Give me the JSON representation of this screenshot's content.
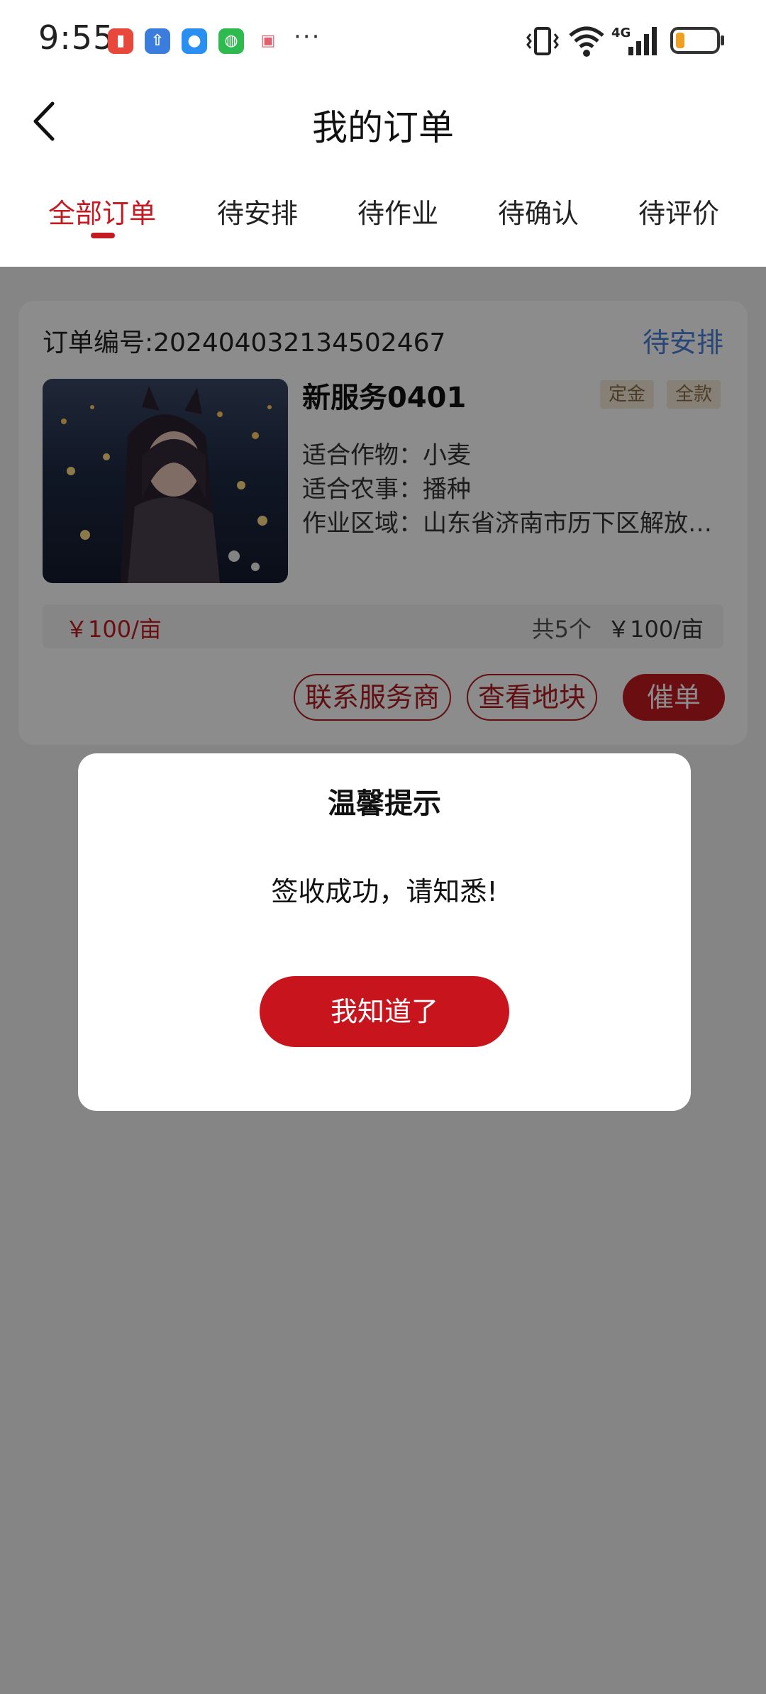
{
  "status_bar": {
    "time": "9:55",
    "more": "···",
    "icons": [
      "battery-saver-app-icon",
      "upload-app-icon",
      "message-app-icon",
      "wechat-icon",
      "box-app-icon",
      "vibrate-icon",
      "wifi-icon",
      "signal-4g-icon",
      "battery-icon"
    ],
    "network": "4G"
  },
  "nav": {
    "title": "我的订单"
  },
  "tabs": [
    {
      "label": "全部订单",
      "active": true
    },
    {
      "label": "待安排",
      "active": false
    },
    {
      "label": "待作业",
      "active": false
    },
    {
      "label": "待确认",
      "active": false
    },
    {
      "label": "待评价",
      "active": false
    }
  ],
  "order": {
    "order_no": "订单编号:202404032134502467",
    "status": "待安排",
    "service_name": "新服务0401",
    "tags": [
      "定金",
      "全款"
    ],
    "crop_label": "适合作物：",
    "crop_value": "小麦",
    "farm_label": "适合农事：",
    "farm_value": "播种",
    "area_label": "作业区域：",
    "area_value": "山东省济南市历下区解放…",
    "unit_price": "￥100/亩",
    "count": "共5个",
    "total_price": "￥100/亩",
    "buttons": {
      "contact": "联系服务商",
      "view_plot": "查看地块",
      "urge": "催单"
    }
  },
  "dialog": {
    "title": "温馨提示",
    "message": "签收成功，请知悉!",
    "confirm": "我知道了"
  },
  "colors": {
    "accent": "#c41a21",
    "status_blue": "#4a80d8",
    "overlay": "rgba(0,0,0,0.45)",
    "tag_bg": "#f4ead9",
    "tag_text": "#8a6d46"
  }
}
